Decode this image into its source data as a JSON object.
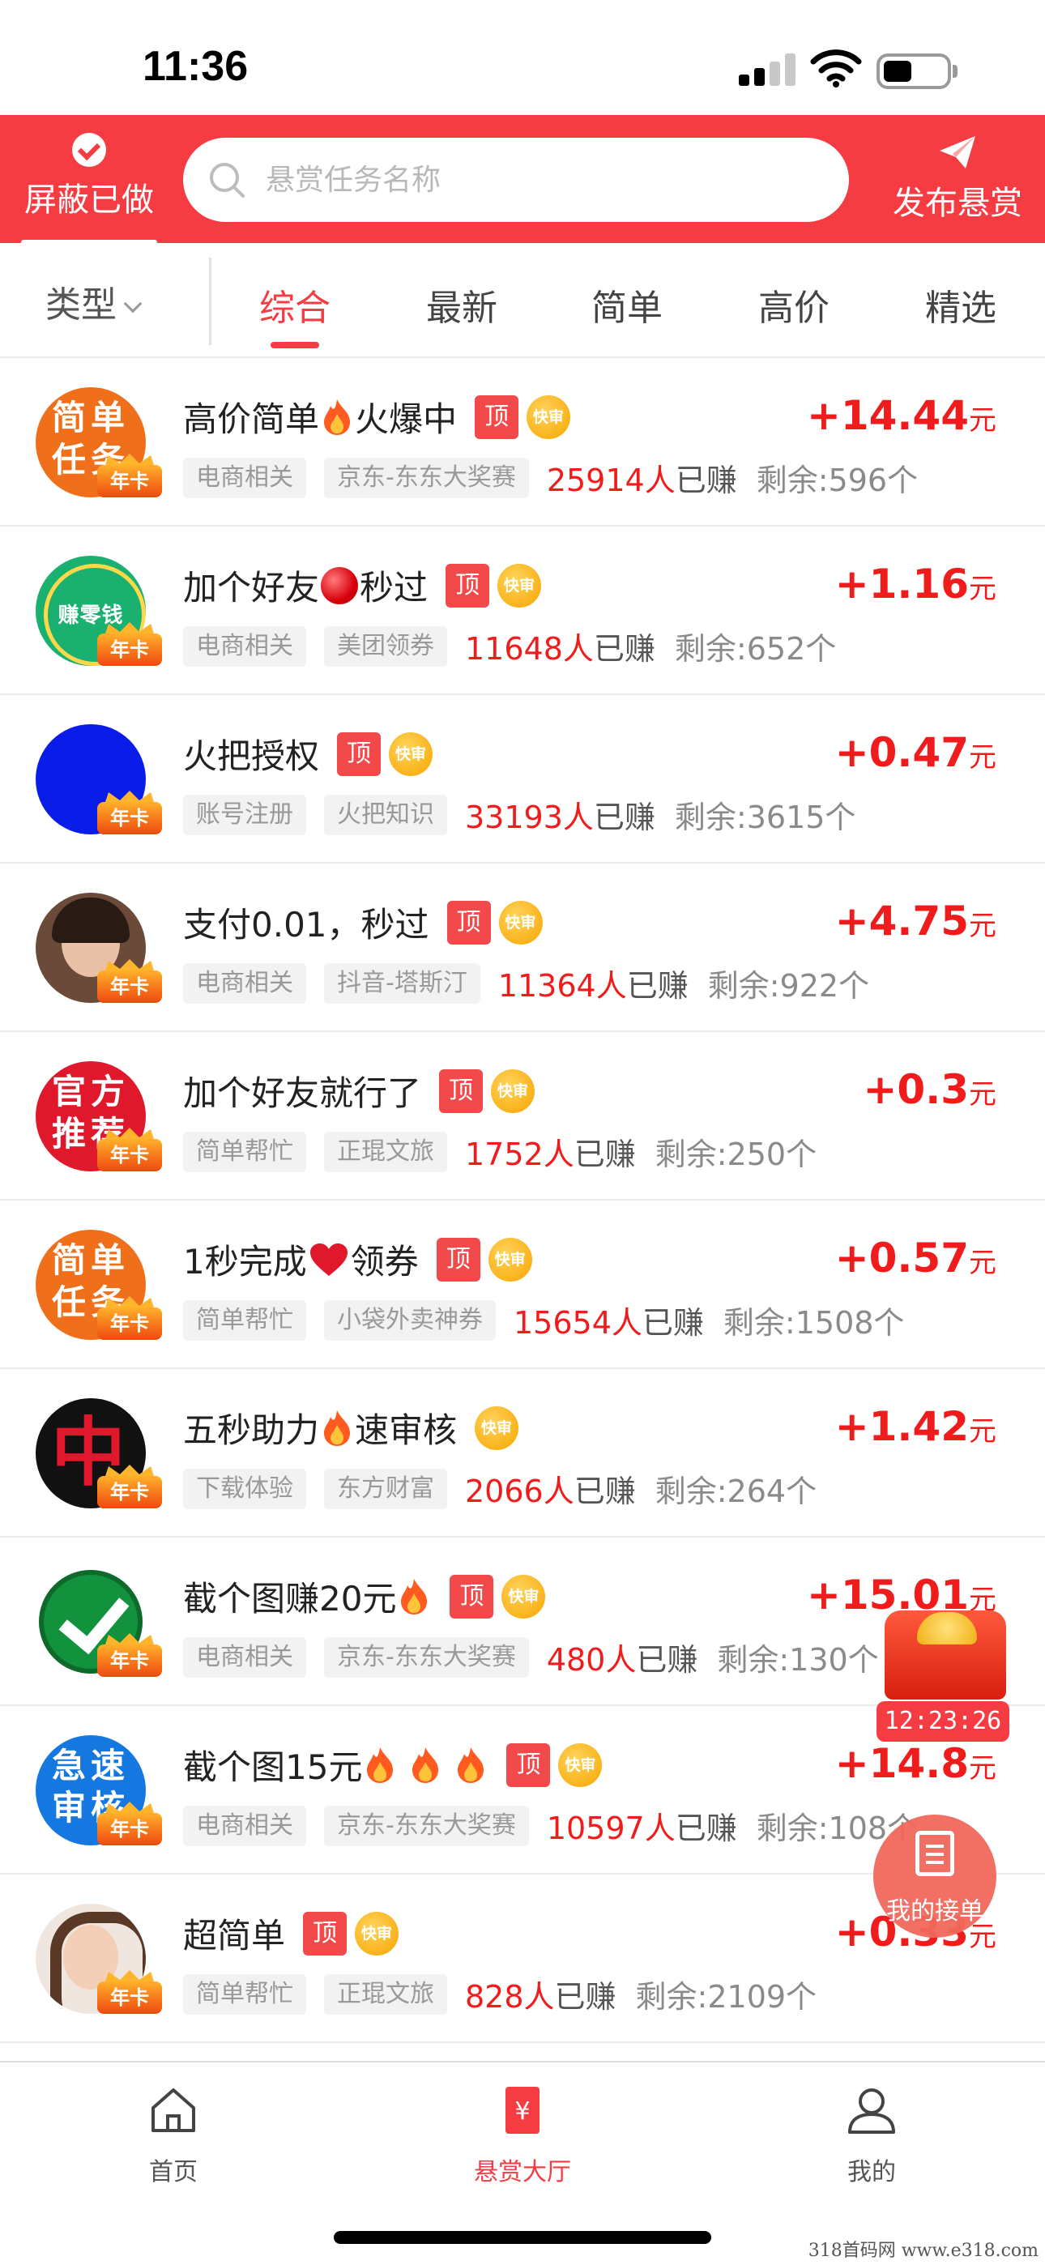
{
  "status_bar": {
    "time": "11:36"
  },
  "header": {
    "hide_done_label": "屏蔽已做",
    "search_placeholder": "悬赏任务名称",
    "publish_label": "发布悬赏",
    "accent_color": "#f53c42"
  },
  "filter": {
    "type_label": "类型",
    "tabs": [
      {
        "label": "综合",
        "active": true
      },
      {
        "label": "最新",
        "active": false
      },
      {
        "label": "简单",
        "active": false
      },
      {
        "label": "高价",
        "active": false
      },
      {
        "label": "精选",
        "active": false
      }
    ]
  },
  "tasks": [
    {
      "avatar_text": "简单任务",
      "badge": "年卡",
      "title": "高价简单",
      "emoji": [
        "fire-icon"
      ],
      "title_suffix": "火爆中",
      "top": "顶",
      "fast": "快审",
      "tags": [
        "电商相关",
        "京东-东东大奖赛"
      ],
      "earned_count": "25914人",
      "earned_suffix": "已赚",
      "remaining": "剩余:596个",
      "reward": "+14.44",
      "unit": "元"
    },
    {
      "avatar_text": "赚零钱",
      "badge": "年卡",
      "title": "加个好友",
      "emoji": [
        "red-dot-icon"
      ],
      "title_suffix": "秒过",
      "top": "顶",
      "fast": "快审",
      "tags": [
        "电商相关",
        "美团领券"
      ],
      "earned_count": "11648人",
      "earned_suffix": "已赚",
      "remaining": "剩余:652个",
      "reward": "+1.16",
      "unit": "元"
    },
    {
      "avatar_text": "",
      "badge": "年卡",
      "title": "火把授权",
      "emoji": [],
      "title_suffix": "",
      "top": "顶",
      "fast": "快审",
      "tags": [
        "账号注册",
        "火把知识"
      ],
      "earned_count": "33193人",
      "earned_suffix": "已赚",
      "remaining": "剩余:3615个",
      "reward": "+0.47",
      "unit": "元"
    },
    {
      "avatar_text": "",
      "badge": "年卡",
      "title": "支付0.01，秒过",
      "emoji": [],
      "title_suffix": "",
      "top": "顶",
      "fast": "快审",
      "tags": [
        "电商相关",
        "抖音-塔斯汀"
      ],
      "earned_count": "11364人",
      "earned_suffix": "已赚",
      "remaining": "剩余:922个",
      "reward": "+4.75",
      "unit": "元"
    },
    {
      "avatar_text": "官方推荐",
      "badge": "年卡",
      "title": "加个好友就行了",
      "emoji": [],
      "title_suffix": "",
      "top": "顶",
      "fast": "快审",
      "tags": [
        "简单帮忙",
        "正琨文旅"
      ],
      "earned_count": "1752人",
      "earned_suffix": "已赚",
      "remaining": "剩余:250个",
      "reward": "+0.3",
      "unit": "元"
    },
    {
      "avatar_text": "简单任务",
      "badge": "年卡",
      "title": "1秒完成",
      "emoji": [
        "heart-icon"
      ],
      "title_suffix": "领券",
      "top": "顶",
      "fast": "快审",
      "tags": [
        "简单帮忙",
        "小袋外卖神券"
      ],
      "earned_count": "15654人",
      "earned_suffix": "已赚",
      "remaining": "剩余:1508个",
      "reward": "+0.57",
      "unit": "元"
    },
    {
      "avatar_text": "中",
      "badge": "年卡",
      "title": "五秒助力",
      "emoji": [
        "fire-icon"
      ],
      "title_suffix": "速审核",
      "top": "",
      "fast": "快审",
      "tags": [
        "下载体验",
        "东方财富"
      ],
      "earned_count": "2066人",
      "earned_suffix": "已赚",
      "remaining": "剩余:264个",
      "reward": "+1.42",
      "unit": "元"
    },
    {
      "avatar_text": "",
      "badge": "年卡",
      "title": "截个图赚20元",
      "emoji": [
        "fire-icon"
      ],
      "title_suffix": "",
      "top": "顶",
      "fast": "快审",
      "tags": [
        "电商相关",
        "京东-东东大奖赛"
      ],
      "earned_count": "480人",
      "earned_suffix": "已赚",
      "remaining": "剩余:130个",
      "reward": "+15.01",
      "unit": "元"
    },
    {
      "avatar_text": "急速审核",
      "badge": "年卡",
      "title": "截个图15元",
      "emoji": [
        "fire-icon",
        "fire-icon",
        "fire-icon"
      ],
      "title_suffix": "",
      "top": "顶",
      "fast": "快审",
      "tags": [
        "电商相关",
        "京东-东东大奖赛"
      ],
      "earned_count": "10597人",
      "earned_suffix": "已赚",
      "remaining": "剩余:108个",
      "reward": "+14.8",
      "unit": "元"
    },
    {
      "avatar_text": "",
      "badge": "年卡",
      "title": "超简单",
      "emoji": [],
      "title_suffix": "",
      "top": "顶",
      "fast": "快审",
      "tags": [
        "简单帮忙",
        "正琨文旅"
      ],
      "earned_count": "828人",
      "earned_suffix": "已赚",
      "remaining": "剩余:2109个",
      "reward": "+0.33",
      "unit": "元"
    }
  ],
  "floating": {
    "red_packet_timer": "12:23:26",
    "my_orders_label": "我的接单"
  },
  "bottom_nav": [
    {
      "label": "首页",
      "icon": "home-icon",
      "active": false
    },
    {
      "label": "悬赏大厅",
      "icon": "bounty-hall-icon",
      "active": true
    },
    {
      "label": "我的",
      "icon": "profile-icon",
      "active": false
    }
  ],
  "watermark": "318首码网  www.e318.com"
}
